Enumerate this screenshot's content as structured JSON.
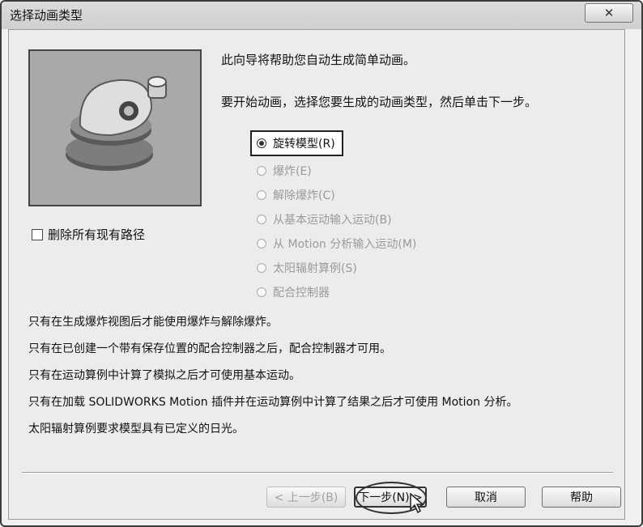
{
  "window": {
    "title": "选择动画类型",
    "close_glyph": "✕"
  },
  "intro": {
    "line1": "此向导将帮助您自动生成简单动画。",
    "line2": "要开始动画，选择您要生成的动画类型，然后单击下一步。"
  },
  "checkbox": {
    "label": "删除所有现有路径",
    "checked": false
  },
  "animation_types": [
    {
      "label": "旋转模型(R)",
      "selected": true,
      "enabled": true
    },
    {
      "label": "爆炸(E)",
      "selected": false,
      "enabled": false
    },
    {
      "label": "解除爆炸(C)",
      "selected": false,
      "enabled": false
    },
    {
      "label": "从基本运动输入运动(B)",
      "selected": false,
      "enabled": false
    },
    {
      "label": "从 Motion 分析输入运动(M)",
      "selected": false,
      "enabled": false
    },
    {
      "label": "太阳辐射算例(S)",
      "selected": false,
      "enabled": false
    },
    {
      "label": "配合控制器",
      "selected": false,
      "enabled": false
    }
  ],
  "notes": [
    "只有在生成爆炸视图后才能使用爆炸与解除爆炸。",
    "只有在已创建一个带有保存位置的配合控制器之后，配合控制器才可用。",
    "只有在运动算例中计算了模拟之后才可使用基本运动。",
    "只有在加载 SOLIDWORKS Motion 插件并在运动算例中计算了结果之后才可使用 Motion 分析。",
    "太阳辐射算例要求模型具有已定义的日光。"
  ],
  "buttons": {
    "back": "< 上一步(B)",
    "next": "下一步(N) >",
    "cancel": "取消",
    "help": "帮助"
  },
  "colors": {
    "dialog_bg": "#ececec",
    "preview_bg": "#a9a9a9",
    "disabled_text": "#9a9a9a"
  }
}
